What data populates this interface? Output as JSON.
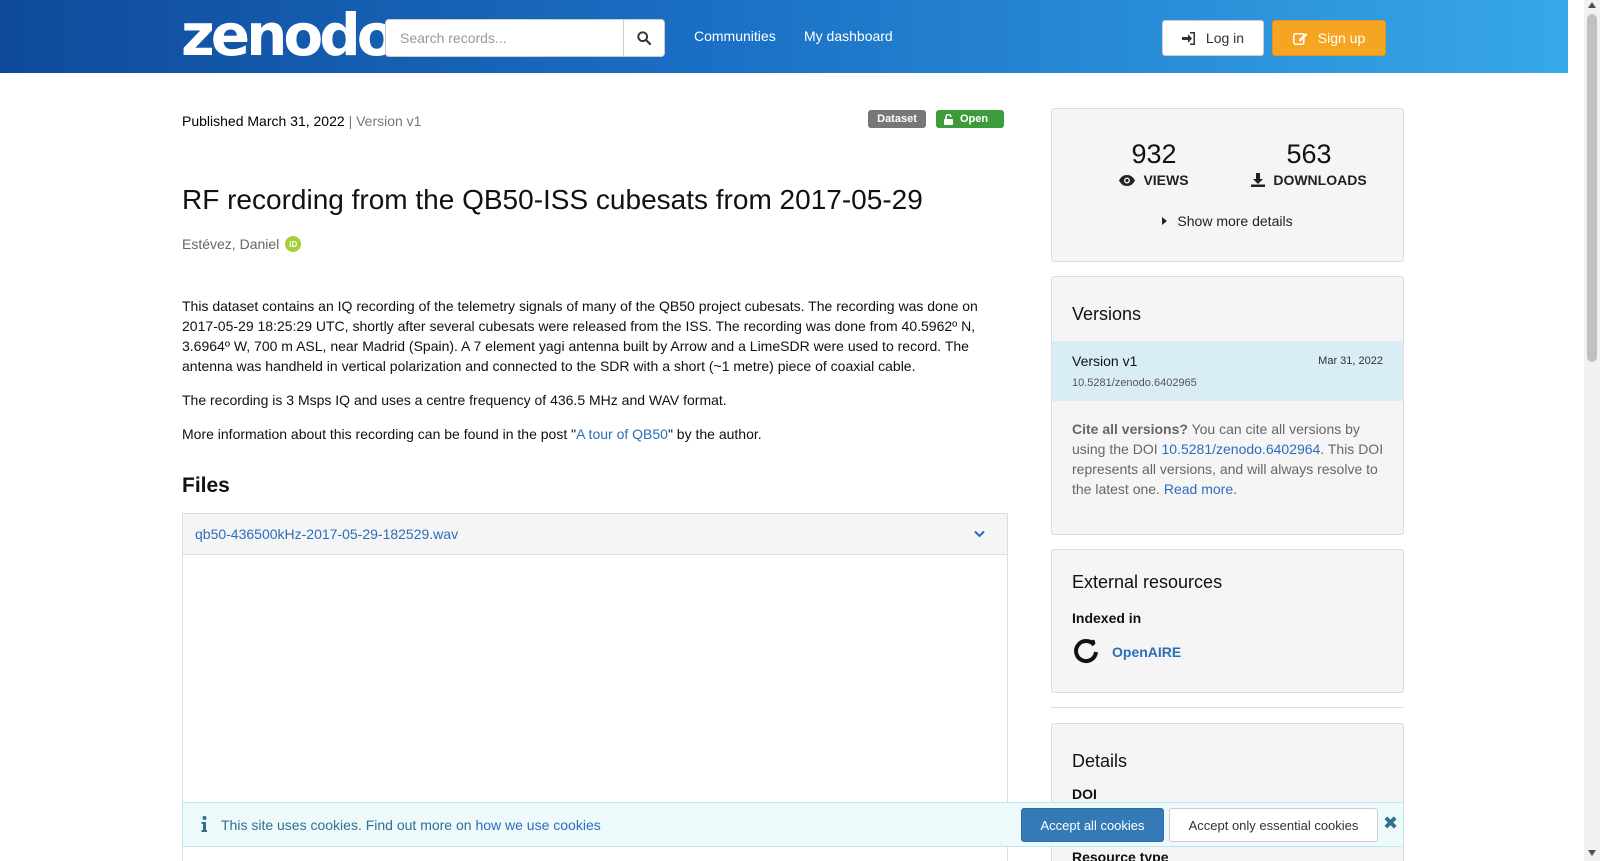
{
  "header": {
    "logo": "zenodo",
    "search_placeholder": "Search records...",
    "nav": [
      "Communities",
      "My dashboard"
    ],
    "login_label": "Log in",
    "signup_label": "Sign up"
  },
  "record": {
    "published_prefix": "Published March 31, 2022",
    "version_suffix": "| Version v1",
    "badge_type": "Dataset",
    "badge_access": "Open",
    "title": "RF recording from the QB50-ISS cubesats from 2017-05-29",
    "author": "Estévez, Daniel",
    "orcid_label": "iD",
    "description": {
      "p1": "This dataset contains an IQ recording of the telemetry signals of many of the QB50 project cubesats. The recording was done on 2017-05-29 18:25:29 UTC, shortly after several cubesats were released from the ISS. The recording was done from 40.5962º N, 3.6964º W, 700 m ASL, near Madrid (Spain). A 7 element yagi antenna built by Arrow and a LimeSDR were used to record. The antenna was handheld in vertical polarization and connected to the SDR with a short (~1 metre) piece of coaxial cable.",
      "p2": "The recording is 3 Msps IQ and uses a centre frequency of 436.5 MHz and WAV format.",
      "p3_before": "More information about this recording can be found in the post \"",
      "p3_link": "A tour of QB50",
      "p3_after": "\" by the author."
    },
    "files_heading": "Files",
    "file_name": "qb50-436500kHz-2017-05-29-182529.wav"
  },
  "stats": {
    "views": "932",
    "views_label": "VIEWS",
    "downloads": "563",
    "downloads_label": "DOWNLOADS",
    "show_more": "Show more details"
  },
  "versions": {
    "title": "Versions",
    "item_name": "Version v1",
    "item_date": "Mar 31, 2022",
    "item_doi": "10.5281/zenodo.6402965",
    "cite_bold": "Cite all versions?",
    "cite_text1": " You can cite all versions by using the DOI ",
    "cite_doi": "10.5281/zenodo.6402964",
    "cite_text2": ". This DOI represents all versions, and will always resolve to the latest one. ",
    "read_more": "Read more."
  },
  "external": {
    "title": "External resources",
    "indexed_label": "Indexed in",
    "openaire": "OpenAIRE"
  },
  "details": {
    "title": "Details",
    "doi_label": "DOI",
    "resource_type_label": "Resource type"
  },
  "cookie": {
    "text": "This site uses cookies. Find out more on ",
    "link": "how we use cookies",
    "accept_all": "Accept all cookies",
    "accept_essential": "Accept only essential cookies"
  },
  "colors": {
    "header_start": "#0f4a9a",
    "header_end": "#37a8e8",
    "signup": "#f6a522",
    "open_badge": "#3c9c3c",
    "link": "#2a6ebb"
  }
}
